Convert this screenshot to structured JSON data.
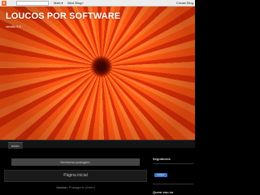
{
  "navbar": {
    "logo": "B",
    "more_label": "Mais ▾",
    "next_label": "Next Blog»",
    "create_label": "Create Blog"
  },
  "header": {
    "title": "LOUCOS POR SOFTWARE",
    "description": "versão 2.0"
  },
  "tabs": [
    {
      "label": "Início"
    }
  ],
  "main": {
    "no_posts": "Nenhuma postagem.",
    "home_link": "Página inicial",
    "subscribe_prefix": "Assinar:",
    "subscribe_link": "Postagens (Atom)"
  },
  "sidebar": {
    "followers_title": "Seguidores",
    "follow_button": "Follow",
    "about_title": "Quem sou eu"
  },
  "colors": {
    "background": "#000000",
    "header_accent": "#ff5a14",
    "follow_button": "#3b79c7"
  }
}
